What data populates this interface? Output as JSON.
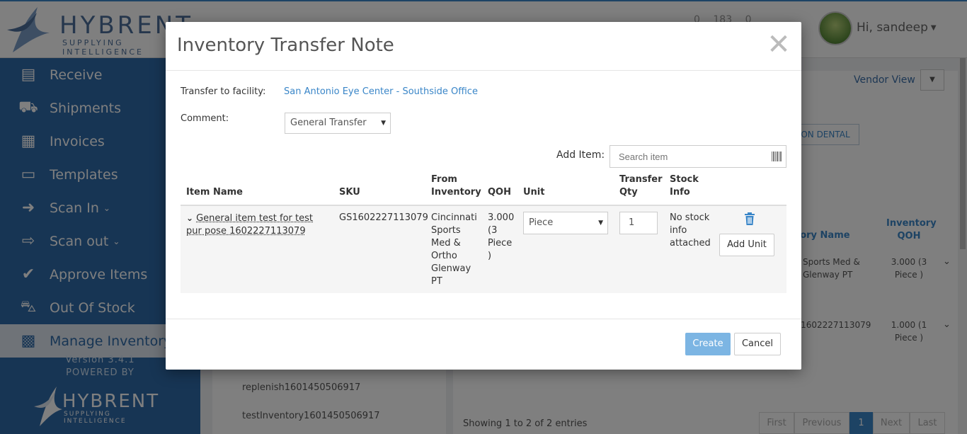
{
  "app": {
    "logo_text": "HYBRENT",
    "logo_tagline": "SUPPLYING INTELLIGENCE",
    "header_counts": [
      "0",
      "183",
      "0"
    ],
    "user_greeting": "Hi, sandeep"
  },
  "sidebar": {
    "items": [
      {
        "label": "Receive",
        "icon": "receive-icon"
      },
      {
        "label": "Shipments",
        "icon": "truck-icon"
      },
      {
        "label": "Invoices",
        "icon": "invoice-icon"
      },
      {
        "label": "Templates",
        "icon": "clipboard-icon"
      },
      {
        "label": "Scan In",
        "icon": "scan-in-icon"
      },
      {
        "label": "Scan out",
        "icon": "scan-out-icon"
      },
      {
        "label": "Approve Items",
        "icon": "check-icon"
      },
      {
        "label": "Out Of Stock",
        "icon": "cart-icon"
      },
      {
        "label": "Manage Inventory",
        "icon": "grid-icon"
      }
    ],
    "version": "Version 3.4.1",
    "powered_by": "POWERED BY",
    "footer_logo_text": "HYBRENT",
    "footer_logo_tagline": "SUPPLYING INTELLIGENCE"
  },
  "background": {
    "vendor_view": "Vendor View",
    "dental_button": "ON DENTAL",
    "col_inventory_name": "tory Name",
    "col_inventory_qoh": "Inventory QOH",
    "rows": [
      {
        "name": "Sports Med & Glenway PT",
        "qoh": "3.000 (3 Piece )"
      },
      {
        "name": "y1602227113079",
        "qoh": "1.000 (1 Piece )"
      }
    ],
    "left_list": [
      "replenish1601450506917",
      "testInventory1601450506917"
    ],
    "showing": "Showing 1 to 2 of 2 entries",
    "pager": [
      "First",
      "Previous",
      "1",
      "Next",
      "Last"
    ]
  },
  "modal": {
    "title": "Inventory Transfer Note",
    "transfer_to_label": "Transfer to facility:",
    "transfer_to_value": "San Antonio Eye Center - Southside Office",
    "comment_label": "Comment:",
    "comment_value": "General Transfer",
    "add_item_label": "Add Item:",
    "search_placeholder": "Search item",
    "columns": {
      "item_name": "Item Name",
      "sku": "SKU",
      "from_inventory": "From Inventory",
      "qoh": "QOH",
      "unit": "Unit",
      "transfer_qty": "Transfer Qty",
      "stock_info": "Stock Info"
    },
    "row": {
      "item_name": "General item test for test pur pose 1602227113079",
      "sku": "GS1602227113079",
      "from_inventory": "Cincinnati Sports Med & Ortho Glenway PT",
      "qoh": "3.000 (3 Piece )",
      "unit": "Piece",
      "transfer_qty": "1",
      "stock_info": "No stock info attached",
      "add_unit": "Add Unit"
    },
    "create_label": "Create",
    "cancel_label": "Cancel"
  }
}
